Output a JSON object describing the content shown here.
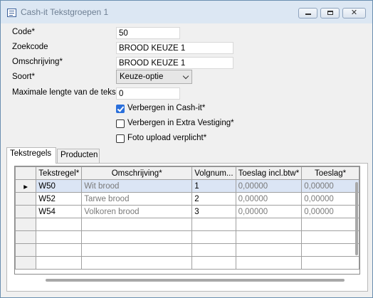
{
  "window": {
    "title": "Cash-it Tekstgroepen 1",
    "app_icon": "list-window-icon",
    "controls": {
      "minimize": "minimize-icon",
      "maximize": "maximize-icon",
      "close_label": "✕"
    }
  },
  "form": {
    "code_label": "Code*",
    "code_value": "50",
    "zoekcode_label": "Zoekcode",
    "zoekcode_value": "BROOD KEUZE 1",
    "omschrijving_label": "Omschrijving*",
    "omschrijving_value": "BROOD KEUZE 1",
    "soort_label": "Soort*",
    "soort_value": "Keuze-optie",
    "maxlen_label": "Maximale lengte van de tekst*",
    "maxlen_value": "0"
  },
  "checkboxes": [
    {
      "label": "Verbergen in Cash-it*",
      "checked": true
    },
    {
      "label": "Verbergen in Extra Vestiging*",
      "checked": false
    },
    {
      "label": "Foto upload verplicht*",
      "checked": false
    }
  ],
  "tabs": [
    {
      "label": "Tekstregels",
      "active": true
    },
    {
      "label": "Producten",
      "active": false
    }
  ],
  "grid": {
    "columns": [
      "",
      "Tekstregel*",
      "Omschrijving*",
      "Volgnum...",
      "Toeslag incl.btw*",
      "Toeslag*"
    ],
    "rows": [
      {
        "indicator": "▸",
        "code": "W50",
        "omschrijving": "Wit brood",
        "volgnummer": "1",
        "toeslag_incl": "0,00000",
        "toeslag": "0,00000",
        "selected": true
      },
      {
        "indicator": "",
        "code": "W52",
        "omschrijving": "Tarwe brood",
        "volgnummer": "2",
        "toeslag_incl": "0,00000",
        "toeslag": "0,00000",
        "selected": false
      },
      {
        "indicator": "",
        "code": "W54",
        "omschrijving": "Volkoren brood",
        "volgnummer": "3",
        "toeslag_incl": "0,00000",
        "toeslag": "0,00000",
        "selected": false
      }
    ],
    "empty_rows": 4
  },
  "colors": {
    "accent": "#2a6fdb",
    "selected_row": "#dbe5f5",
    "titlebar": "#dce7f3"
  }
}
